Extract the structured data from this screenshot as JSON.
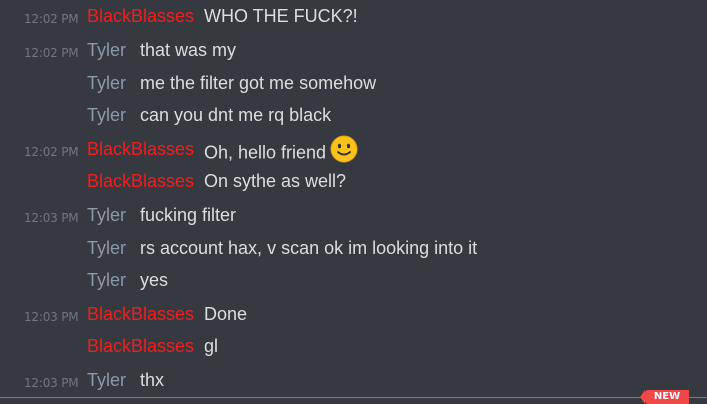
{
  "messages": [
    {
      "time": "12:02 PM",
      "author": "BlackBlasses",
      "text": "WHO THE FUCK?!"
    },
    {
      "time": "12:02 PM",
      "author": "Tyler",
      "text": "that was my"
    },
    {
      "time": "",
      "author": "Tyler",
      "text": "me the filter got me somehow"
    },
    {
      "time": "",
      "author": "Tyler",
      "text": "can you dnt me rq black"
    },
    {
      "time": "12:02 PM",
      "author": "BlackBlasses",
      "text": "Oh, hello friend",
      "emoji": "slightly-smiling-face-icon"
    },
    {
      "time": "",
      "author": "BlackBlasses",
      "text": "On sythe as well?"
    },
    {
      "time": "12:03 PM",
      "author": "Tyler",
      "text": "fucking filter"
    },
    {
      "time": "",
      "author": "Tyler",
      "text": "rs account hax, v scan ok im looking into it"
    },
    {
      "time": "",
      "author": "Tyler",
      "text": "yes"
    },
    {
      "time": "12:03 PM",
      "author": "BlackBlasses",
      "text": "Done"
    },
    {
      "time": "",
      "author": "BlackBlasses",
      "text": "gl"
    },
    {
      "time": "12:03 PM",
      "author": "Tyler",
      "text": "thx"
    }
  ],
  "new_marker": {
    "label": "NEW",
    "color": "#f04747"
  },
  "colors": {
    "background": "#36393f",
    "blackblasses_name": "#f01f1f",
    "tyler_name": "#8a9aa9",
    "message_text": "#dcddde",
    "timestamp": "#72767d"
  }
}
